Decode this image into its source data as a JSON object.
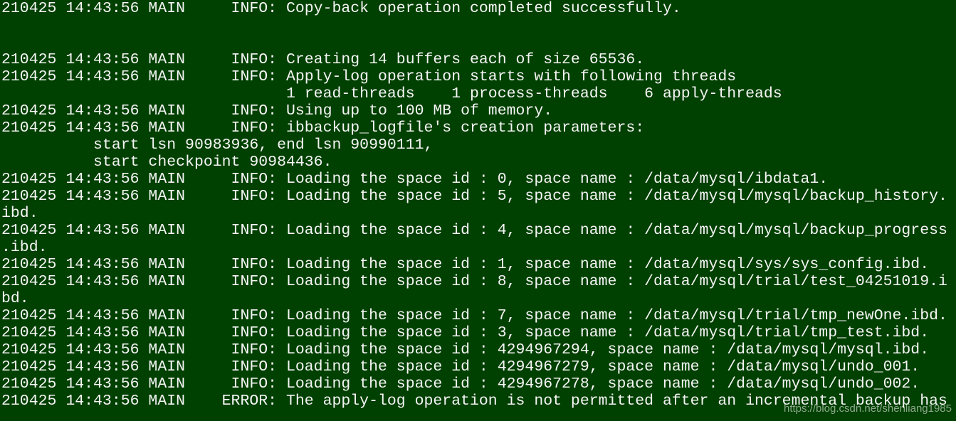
{
  "terminal": {
    "lines": [
      "210425 14:43:56 MAIN     INFO: Copy-back operation completed successfully.",
      "",
      "",
      "210425 14:43:56 MAIN     INFO: Creating 14 buffers each of size 65536.",
      "210425 14:43:56 MAIN     INFO: Apply-log operation starts with following threads",
      "                               1 read-threads    1 process-threads    6 apply-threads",
      "210425 14:43:56 MAIN     INFO: Using up to 100 MB of memory.",
      "210425 14:43:56 MAIN     INFO: ibbackup_logfile's creation parameters:",
      "          start lsn 90983936, end lsn 90990111,",
      "          start checkpoint 90984436.",
      "210425 14:43:56 MAIN     INFO: Loading the space id : 0, space name : /data/mysql/ibdata1.",
      "210425 14:43:56 MAIN     INFO: Loading the space id : 5, space name : /data/mysql/mysql/backup_history.",
      "ibd.",
      "210425 14:43:56 MAIN     INFO: Loading the space id : 4, space name : /data/mysql/mysql/backup_progress",
      ".ibd.",
      "210425 14:43:56 MAIN     INFO: Loading the space id : 1, space name : /data/mysql/sys/sys_config.ibd.",
      "210425 14:43:56 MAIN     INFO: Loading the space id : 8, space name : /data/mysql/trial/test_04251019.i",
      "bd.",
      "210425 14:43:56 MAIN     INFO: Loading the space id : 7, space name : /data/mysql/trial/tmp_newOne.ibd.",
      "210425 14:43:56 MAIN     INFO: Loading the space id : 3, space name : /data/mysql/trial/tmp_test.ibd.",
      "210425 14:43:56 MAIN     INFO: Loading the space id : 4294967294, space name : /data/mysql/mysql.ibd.",
      "210425 14:43:56 MAIN     INFO: Loading the space id : 4294967279, space name : /data/mysql/undo_001.",
      "210425 14:43:56 MAIN     INFO: Loading the space id : 4294967278, space name : /data/mysql/undo_002.",
      "210425 14:43:56 MAIN    ERROR: The apply-log operation is not permitted after an incremental backup has"
    ],
    "watermark": "https://blog.csdn.net/shenliang1985"
  },
  "colors": {
    "background": "#004000",
    "text": "#f5f5f5"
  }
}
